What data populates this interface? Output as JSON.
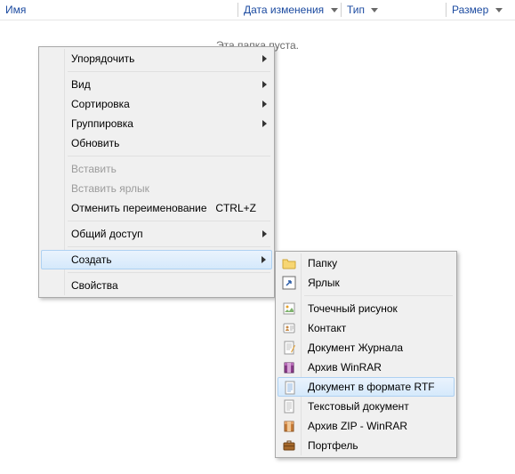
{
  "columns": {
    "name": {
      "label": "Имя"
    },
    "date": {
      "label": "Дата изменения"
    },
    "type": {
      "label": "Тип"
    },
    "size": {
      "label": "Размер"
    }
  },
  "empty_folder_text": "Эта папка пуста.",
  "context_menu": {
    "arrange": "Упорядочить",
    "view": "Вид",
    "sort": "Сортировка",
    "group": "Группировка",
    "refresh": "Обновить",
    "paste": "Вставить",
    "paste_shortcut": "Вставить ярлык",
    "undo_rename": "Отменить переименование",
    "undo_shortcut": "CTRL+Z",
    "share": "Общий доступ",
    "create": "Создать",
    "properties": "Свойства"
  },
  "submenu": {
    "folder": "Папку",
    "shortcut": "Ярлык",
    "bitmap": "Точечный рисунок",
    "contact": "Контакт",
    "journal": "Документ Журнала",
    "winrar": "Архив WinRAR",
    "rtf": "Документ в формате RTF",
    "text": "Текстовый документ",
    "zip": "Архив ZIP - WinRAR",
    "briefcase": "Портфель"
  }
}
